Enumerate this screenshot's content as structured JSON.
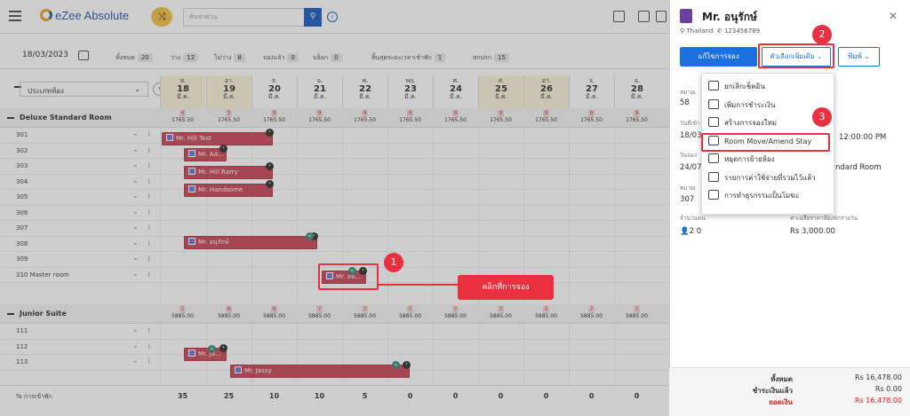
{
  "app": {
    "title": "eZee Absolute",
    "search_placeholder": "ค้นหาด่วน"
  },
  "toolbar": {
    "date": "18/03/2023",
    "stats": [
      {
        "label": "ทั้งหมด",
        "count": "20"
      },
      {
        "label": "ว่าง",
        "count": "12"
      },
      {
        "label": "ไม่ว่าง",
        "count": "8"
      },
      {
        "label": "จองแล้ว",
        "count": "0"
      },
      {
        "label": "บล็อก",
        "count": "0"
      },
      {
        "label": "สิ้นสุดระยะเวลาเช้าพัก",
        "count": "1"
      },
      {
        "label": "สกปรก",
        "count": "15"
      }
    ]
  },
  "room_type_select": "ประเภทห้อง",
  "days": [
    {
      "dow": "ส.",
      "d": "18",
      "m": "มี.ค."
    },
    {
      "dow": "อา.",
      "d": "19",
      "m": "มี.ค."
    },
    {
      "dow": "จ.",
      "d": "20",
      "m": "มี.ค."
    },
    {
      "dow": "อ.",
      "d": "21",
      "m": "มี.ค."
    },
    {
      "dow": "พ.",
      "d": "22",
      "m": "มี.ค."
    },
    {
      "dow": "พฤ.",
      "d": "23",
      "m": "มี.ค."
    },
    {
      "dow": "ศ.",
      "d": "24",
      "m": "มี.ค."
    },
    {
      "dow": "ส.",
      "d": "25",
      "m": "มี.ค."
    },
    {
      "dow": "อา.",
      "d": "26",
      "m": "มี.ค."
    },
    {
      "dow": "จ.",
      "d": "27",
      "m": "มี.ค."
    },
    {
      "dow": "อ.",
      "d": "28",
      "m": "มี.ค."
    }
  ],
  "categories": [
    {
      "name": "Deluxe Standard Room",
      "avail": [
        "4",
        "5",
        "9",
        "9",
        "9",
        "9",
        "9",
        "9",
        "9",
        "9",
        "9"
      ],
      "price": "1765.50",
      "rooms": [
        "301",
        "302",
        "303",
        "304",
        "305",
        "306",
        "307",
        "308",
        "309",
        "310 Master room"
      ]
    },
    {
      "name": "Junior Suite",
      "avail": [
        "5",
        "6",
        "6",
        "7",
        "7",
        "7",
        "7",
        "7",
        "7",
        "7",
        "7"
      ],
      "price": "5885.00",
      "rooms": [
        "111",
        "112",
        "113"
      ]
    }
  ],
  "bookings": [
    {
      "name": "Mr. Hill Test"
    },
    {
      "name": "Mr. AA..."
    },
    {
      "name": "Mr. Hill Rarry"
    },
    {
      "name": "Mr. Handsome"
    },
    {
      "name": "Mr. อนุรักษ์"
    },
    {
      "name": "Mr. อน..."
    },
    {
      "name": "Mr. Ja..."
    },
    {
      "name": "Mr. Jassy"
    }
  ],
  "occupancy": {
    "label": "% การเข้าพัก",
    "values": [
      "35",
      "25",
      "10",
      "10",
      "5",
      "0",
      "0",
      "0",
      "0",
      "0",
      "0"
    ]
  },
  "callouts": {
    "one": "1",
    "two": "2",
    "three": "3",
    "label": "คลิกที่การจอง"
  },
  "panel": {
    "title": "Mr. อนุรักษ์",
    "country": "Thailand",
    "phone": "123456789",
    "edit": "แก้ไขการจอง",
    "more": "ตัวเลือกเพิ่มเติม",
    "print": "พิมพ์",
    "f1l": "หมายเ",
    "f1v": "58",
    "f2l": "วันที่เข้า",
    "f2v": "18/03",
    "f2r": "12:00:00 PM",
    "f3l": "วันจอง",
    "f3v": "24/07",
    "f3r": "ndard Room",
    "f4l": "หมายเ",
    "f4v": "307",
    "guests_label": "จำนวนคน",
    "guests": "2 0",
    "rate_label": "ค่าเฉลี่ยราคาห้องพักรายวัน",
    "rate": "Rs 3,000.00"
  },
  "menu": [
    "ยกเลิกเช็คอิน",
    "เพิ่มการชำระเงิน",
    "สร้างการจองใหม่",
    "Room Move/Amend Stay",
    "หยุดการย้ายห้อง",
    "รายการค่าใช้จ่ายที่รวมไว้แล้ว",
    "การทำธุรกรรมเป็นโมฆะ"
  ],
  "totals": [
    {
      "label": "ทั้งหมด",
      "value": "Rs 16,478.00"
    },
    {
      "label": "ชำระเงินแล้ว",
      "value": "Rs 0.00"
    },
    {
      "label": "ยอดเงิน",
      "value": "Rs 16,478.00"
    }
  ]
}
